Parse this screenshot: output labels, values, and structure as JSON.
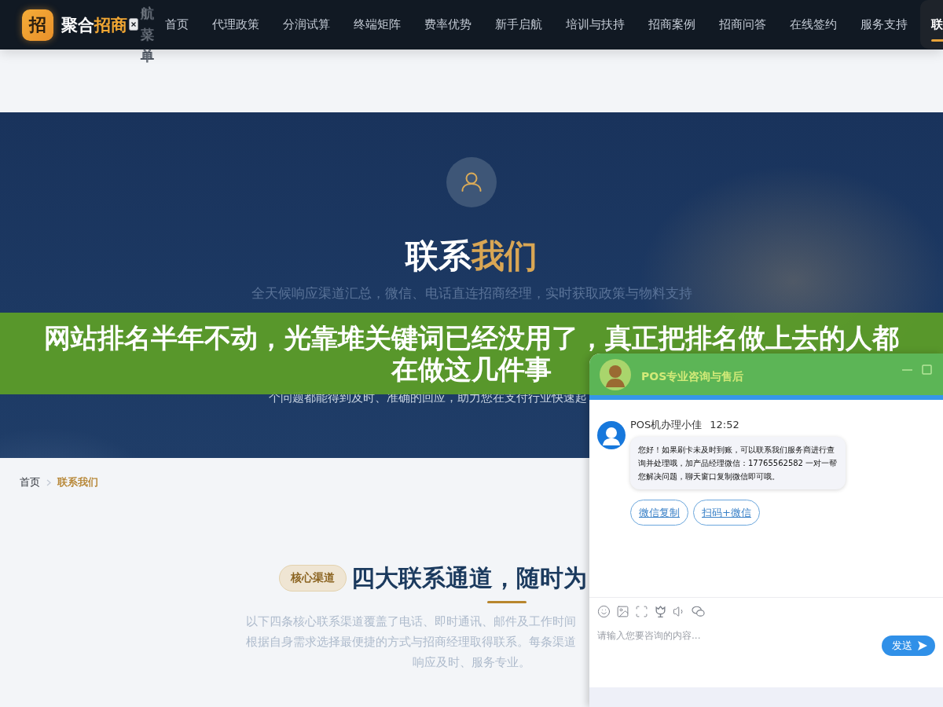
{
  "nav": {
    "brand": {
      "icon_char": "招",
      "name_main": "聚合",
      "name_accent": "招商"
    },
    "menu_label": "航菜单",
    "items": [
      {
        "label": "首页",
        "selected": false
      },
      {
        "label": "代理政策",
        "selected": false
      },
      {
        "label": "分润试算",
        "selected": false
      },
      {
        "label": "终端矩阵",
        "selected": false
      },
      {
        "label": "费率优势",
        "selected": false
      },
      {
        "label": "新手启航",
        "selected": false
      },
      {
        "label": "培训与扶持",
        "selected": false
      },
      {
        "label": "招商案例",
        "selected": false
      },
      {
        "label": "招商问答",
        "selected": false
      },
      {
        "label": "在线签约",
        "selected": false
      },
      {
        "label": "服务支持",
        "selected": false
      },
      {
        "label": "联",
        "selected": true
      }
    ]
  },
  "hero": {
    "title_main": "联系",
    "title_accent": "我们",
    "subtitle": "全天候响应渠道汇总，微信、电话直连招商经理，实时获取政策与物料支持",
    "paragraph_lines": [
      "个问题都能得到及时、准确的回应，助力您在支付行业快速起"
    ]
  },
  "banner": {
    "title_lines": [
      "网站排名半年不动，光靠堆关键词已经没用了，真正把排名做上去的人都",
      "在做这几件事"
    ]
  },
  "breadcrumb": [
    {
      "label": "首页",
      "current": false
    },
    {
      "label": "联系我们",
      "current": true
    }
  ],
  "section": {
    "badge": "核心渠道",
    "title": "四大联系通道，随时为",
    "description_lines": [
      "以下四条核心联系渠道覆盖了电话、即时通讯、邮件及工作时间",
      "根据自身需求选择最便捷的方式与招商经理取得联系。每条渠道",
      "响应及时、服务专业。"
    ]
  },
  "chat": {
    "title": "POS专业咨询与售后",
    "messages": [
      {
        "sender": "POS机办理小佳",
        "time": "12:52",
        "text": "您好！如果刷卡未及时到账，可以联系我们服务商进行查询并处理哦，加产品经理微信：17765562582 一对一帮您解决问题，聊天窗口复制微信即可哦。",
        "actions": [
          "微信复制",
          "扫码+微信"
        ]
      }
    ],
    "input": {
      "placeholder": "请输入您要咨询的内容..."
    },
    "send_label": "发送"
  }
}
